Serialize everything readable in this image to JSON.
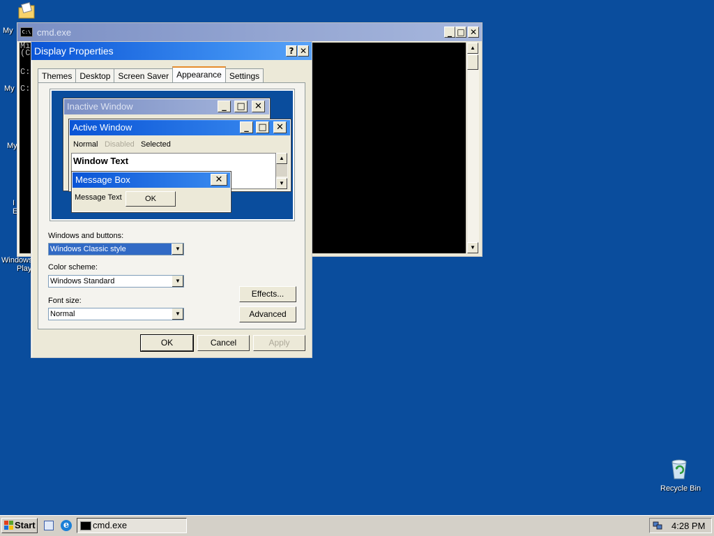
{
  "desktop": {
    "icons": [
      {
        "label": "My",
        "icon": "my-documents-icon"
      },
      {
        "label": "My",
        "icon": "my-computer-icon"
      },
      {
        "label": "My",
        "icon": "my-network-places-icon"
      },
      {
        "label": "I",
        "icon": "internet-explorer-icon"
      },
      {
        "label": "E",
        "icon": "internet-explorer-icon"
      },
      {
        "label": "Windows",
        "icon": "windows-media-player-icon"
      },
      {
        "label": "Play",
        "icon": "windows-media-player-icon"
      }
    ],
    "recycle_bin_label": "Recycle Bin"
  },
  "cmd_window": {
    "title": "cmd.exe",
    "console_lines": [
      "Mi",
      "(C",
      "C:",
      "C:"
    ],
    "buttons": {
      "minimize": "_",
      "maximize": "□",
      "close": "✕"
    }
  },
  "display_properties": {
    "title": "Display Properties",
    "help_button": "?",
    "close_button": "✕",
    "tabs": [
      {
        "label": "Themes",
        "active": false
      },
      {
        "label": "Desktop",
        "active": false
      },
      {
        "label": "Screen Saver",
        "active": false
      },
      {
        "label": "Appearance",
        "active": true
      },
      {
        "label": "Settings",
        "active": false
      }
    ],
    "preview": {
      "inactive_title": "Inactive Window",
      "active_title": "Active Window",
      "menu": {
        "normal": "Normal",
        "disabled": "Disabled",
        "selected": "Selected"
      },
      "window_text": "Window Text",
      "msgbox_title": "Message Box",
      "msgbox_text": "Message Text",
      "msgbox_ok": "OK",
      "btn_minimize": "_",
      "btn_maximize": "□",
      "btn_close": "✕"
    },
    "windows_and_buttons": {
      "label": "Windows and buttons:",
      "value": "Windows Classic style"
    },
    "color_scheme": {
      "label": "Color scheme:",
      "value": "Windows Standard"
    },
    "font_size": {
      "label": "Font size:",
      "value": "Normal"
    },
    "effects_button": "Effects...",
    "advanced_button": "Advanced",
    "ok_button": "OK",
    "cancel_button": "Cancel",
    "apply_button": "Apply"
  },
  "taskbar": {
    "start_label": "Start",
    "task_label": "cmd.exe",
    "clock": "4:28 PM"
  },
  "colors": {
    "desktop": "#0a4d9d",
    "active_title": "#0a54d6",
    "inactive_title": "#7b8fc4"
  }
}
